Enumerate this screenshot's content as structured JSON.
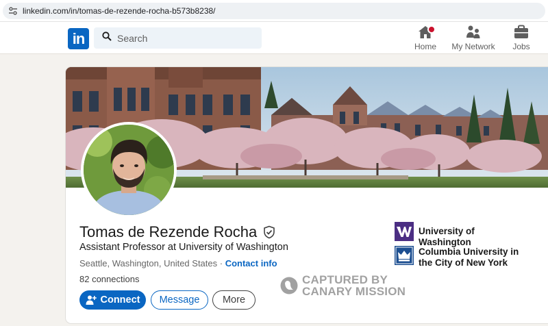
{
  "browser": {
    "url": "linkedin.com/in/tomas-de-rezende-rocha-b573b8238/",
    "site_settings_icon": "tune-icon"
  },
  "nav": {
    "logo_text": "in",
    "search_placeholder": "Search",
    "items": [
      {
        "label": "Home",
        "icon": "home-icon",
        "has_notification": true
      },
      {
        "label": "My Network",
        "icon": "people-icon"
      },
      {
        "label": "Jobs",
        "icon": "briefcase-icon"
      }
    ],
    "brand_color": "#0a66c2"
  },
  "profile": {
    "name": "Tomas de Rezende Rocha",
    "verified_icon": "verified-shield-icon",
    "headline": "Assistant Professor at University of Washington",
    "location": "Seattle, Washington, United States",
    "separator": " · ",
    "contact_info_label": "Contact info",
    "connections": "82 connections",
    "actions": {
      "connect_label": "Connect",
      "message_label": "Message",
      "more_label": "More"
    },
    "education": [
      {
        "name": "University of Washington",
        "color": "#4b2e83"
      },
      {
        "name": "Columbia University in the City of New York",
        "color": "#1d4f91"
      }
    ]
  },
  "watermark": {
    "line1": "CAPTURED BY",
    "line2": "CANARY MISSION"
  }
}
